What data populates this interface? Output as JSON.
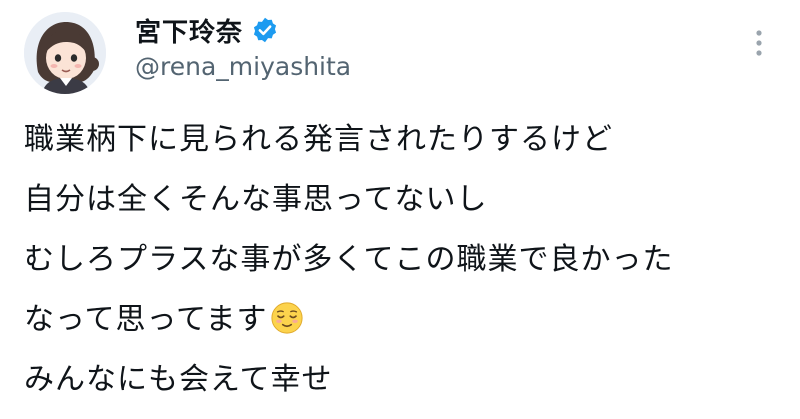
{
  "author": {
    "display_name": "宮下玲奈",
    "handle": "@rena_miyashita",
    "verified_icon": "verified-badge-icon",
    "verified_color": "#1d9bf0"
  },
  "menu": {
    "icon": "more-vertical-icon"
  },
  "tweet": {
    "lines": [
      "職業柄下に見られる発言されたりするけど",
      "自分は全くそんな事思ってないし",
      "むしろプラスな事が多くてこの職業で良かった",
      "なって思ってます",
      "みんなにも会えて幸せ"
    ],
    "emoji": "relieved-face-emoji"
  },
  "colors": {
    "text": "#0f1419",
    "secondary_text": "#536471",
    "background": "#ffffff"
  }
}
